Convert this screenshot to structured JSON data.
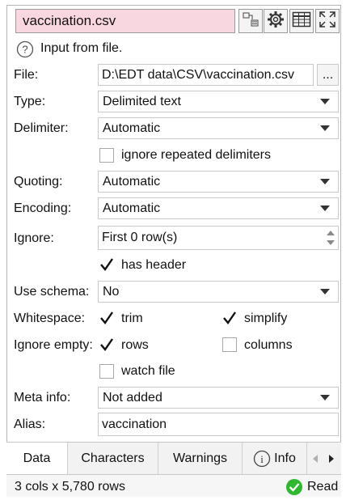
{
  "header": {
    "filename": "vaccination.csv",
    "icons": [
      "transform-icon",
      "settings-icon",
      "table-view-icon",
      "expand-icon"
    ]
  },
  "info": {
    "icon": "help-icon",
    "text": "Input from file."
  },
  "form": {
    "file": {
      "label": "File:",
      "value": "D:\\EDT data\\CSV\\vaccination.csv",
      "browse_label": "..."
    },
    "type": {
      "label": "Type:",
      "value": "Delimited text"
    },
    "delimiter": {
      "label": "Delimiter:",
      "value": "Automatic"
    },
    "ignore_repeated": {
      "label": "ignore repeated delimiters",
      "checked": false
    },
    "quoting": {
      "label": "Quoting:",
      "value": "Automatic"
    },
    "encoding": {
      "label": "Encoding:",
      "value": "Automatic"
    },
    "ignore": {
      "label": "Ignore:",
      "value": "First 0 row(s)"
    },
    "has_header": {
      "label": "has header",
      "checked": true
    },
    "use_schema": {
      "label": "Use schema:",
      "value": "No"
    },
    "whitespace": {
      "label": "Whitespace:",
      "trim": {
        "label": "trim",
        "checked": true
      },
      "simplify": {
        "label": "simplify",
        "checked": true
      }
    },
    "ignore_empty": {
      "label": "Ignore empty:",
      "rows": {
        "label": "rows",
        "checked": true
      },
      "columns": {
        "label": "columns",
        "checked": false
      }
    },
    "watch_file": {
      "label": "watch file",
      "checked": false
    },
    "meta_info": {
      "label": "Meta info:",
      "value": "Not added"
    },
    "alias": {
      "label": "Alias:",
      "value": "vaccination"
    }
  },
  "tabs": [
    {
      "label": "Data",
      "active": true
    },
    {
      "label": "Characters",
      "active": false
    },
    {
      "label": "Warnings",
      "active": false
    },
    {
      "label": "Info",
      "active": false
    }
  ],
  "status": {
    "summary": "3 cols x 5,780 rows",
    "state": "Read",
    "state_color": "#2eb82e"
  },
  "colors": {
    "title_bg": "#f8d7e0",
    "accent_green": "#2eb82e"
  }
}
